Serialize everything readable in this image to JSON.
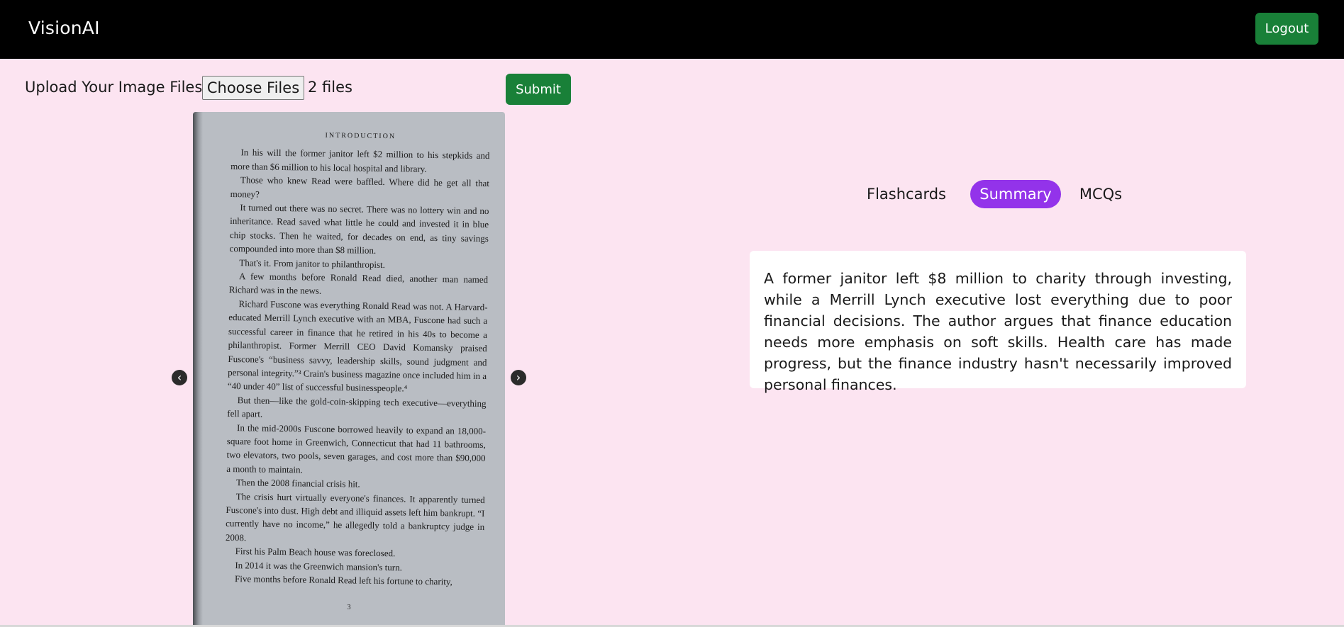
{
  "navbar": {
    "brand": "VisionAI",
    "logout_label": "Logout"
  },
  "upload": {
    "label": "Upload Your Image Files",
    "choose_label": "Choose Files",
    "file_count": "2 files",
    "submit_label": "Submit"
  },
  "carousel": {
    "prev_icon": "chevron-left-icon",
    "next_icon": "chevron-right-icon",
    "page": {
      "heading": "INTRODUCTION",
      "paragraphs": [
        "In his will the former janitor left $2 million to his stepkids and more than $6 million to his local hospital and library.",
        "Those who knew Read were baffled. Where did he get all that money?",
        "It turned out there was no secret. There was no lottery win and no inheritance. Read saved what little he could and invested it in blue chip stocks. Then he waited, for decades on end, as tiny savings compounded into more than $8 million.",
        "That's it. From janitor to philanthropist.",
        "A few months before Ronald Read died, another man named Richard was in the news.",
        "Richard Fuscone was everything Ronald Read was not. A Harvard-educated Merrill Lynch executive with an MBA, Fuscone had such a successful career in finance that he retired in his 40s to become a philanthropist. Former Merrill CEO David Komansky praised Fuscone's “business savvy, leadership skills, sound judgment and personal integrity.”³ Crain's business magazine once included him in a “40 under 40” list of successful businesspeople.⁴",
        "But then—like the gold-coin-skipping tech executive—everything fell apart.",
        "In the mid-2000s Fuscone borrowed heavily to expand an 18,000-square foot home in Greenwich, Connecticut that had 11 bathrooms, two elevators, two pools, seven garages, and cost more than $90,000 a month to maintain.",
        "Then the 2008 financial crisis hit.",
        "The crisis hurt virtually everyone's finances. It apparently turned Fuscone's into dust. High debt and illiquid assets left him bankrupt. “I currently have no income,” he allegedly told a bankruptcy judge in 2008.",
        "First his Palm Beach house was foreclosed.",
        "In 2014 it was the Greenwich mansion's turn.",
        "Five months before Ronald Read left his fortune to charity,"
      ],
      "number": "3"
    }
  },
  "tabs": {
    "flashcards": "Flashcards",
    "summary": "Summary",
    "mcqs": "MCQs",
    "active": "Summary"
  },
  "summary": {
    "text": "A former janitor left $8 million to charity through investing, while a Merrill Lynch executive lost everything due to poor financial decisions. The author argues that finance education needs more emphasis on soft skills. Health care has made progress, but the finance industry hasn't necessarily improved personal finances."
  },
  "colors": {
    "background": "#fce4f1",
    "navbar": "#000000",
    "button_green": "#198038",
    "active_tab": "#9333ea"
  }
}
